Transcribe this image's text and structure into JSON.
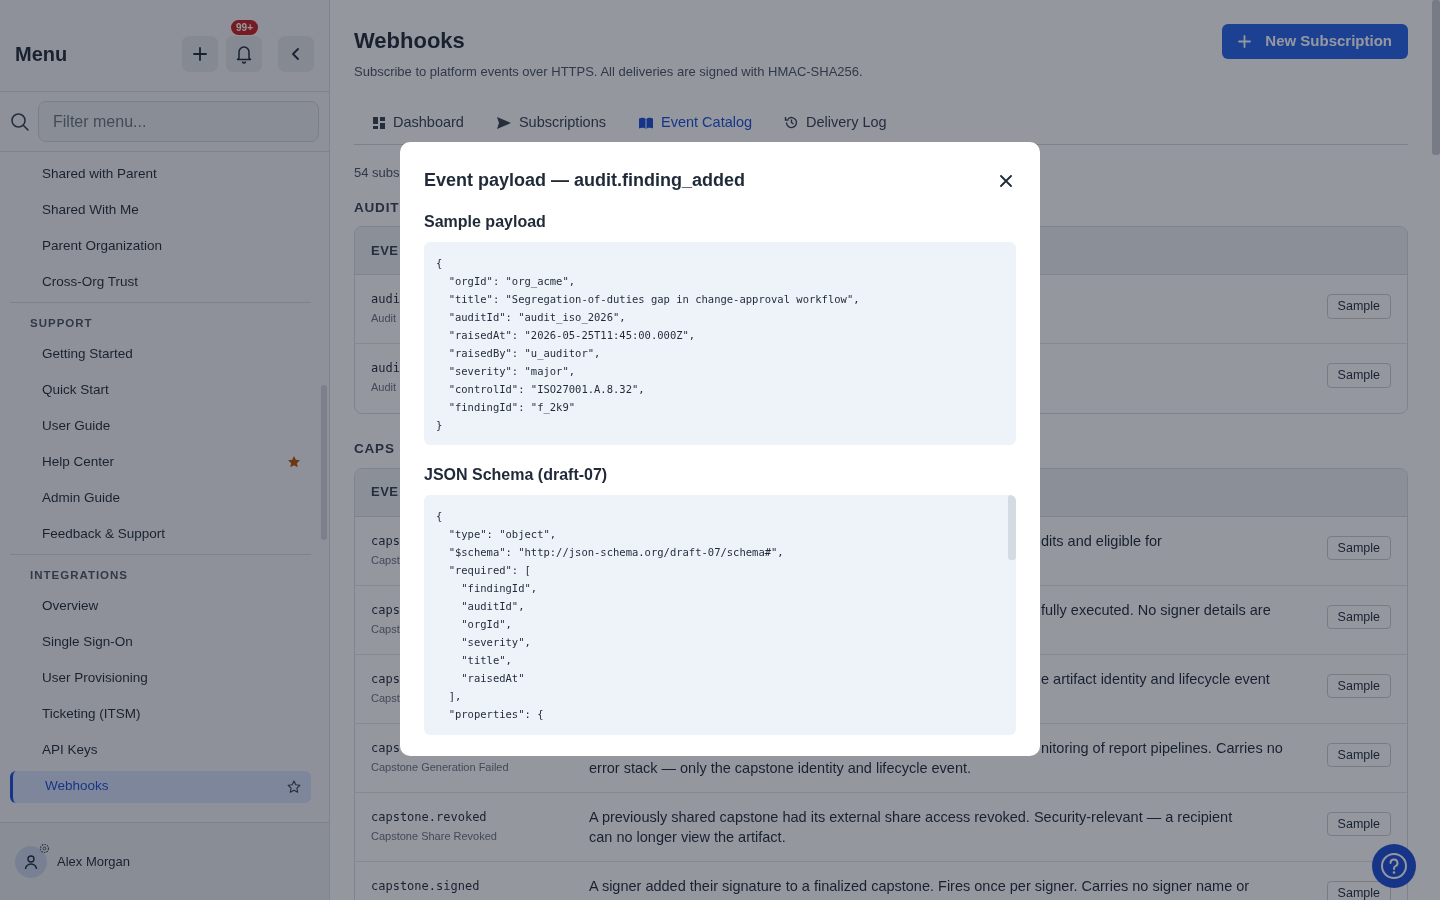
{
  "sidebar": {
    "title": "Menu",
    "notification_badge": "99+",
    "search": {
      "placeholder": "Filter menu..."
    },
    "sections": [
      {
        "items": [
          {
            "label": "Shared with Parent",
            "selected": false
          },
          {
            "label": "Shared With Me",
            "selected": false
          },
          {
            "label": "Parent Organization",
            "selected": false
          },
          {
            "label": "Cross-Org Trust",
            "selected": false
          }
        ]
      },
      {
        "heading": "SUPPORT",
        "items": [
          {
            "label": "Getting Started",
            "selected": false
          },
          {
            "label": "Quick Start",
            "selected": false
          },
          {
            "label": "User Guide",
            "selected": false
          },
          {
            "label": "Help Center",
            "selected": false,
            "favorite": true
          },
          {
            "label": "Admin Guide",
            "selected": false
          },
          {
            "label": "Feedback & Support",
            "selected": false
          }
        ]
      },
      {
        "heading": "INTEGRATIONS",
        "items": [
          {
            "label": "Overview",
            "selected": false
          },
          {
            "label": "Single Sign-On",
            "selected": false
          },
          {
            "label": "User Provisioning",
            "selected": false
          },
          {
            "label": "Ticketing (ITSM)",
            "selected": false
          },
          {
            "label": "API Keys",
            "selected": false
          },
          {
            "label": "Webhooks",
            "selected": true
          }
        ]
      }
    ],
    "user": {
      "name": "Alex Morgan"
    }
  },
  "page": {
    "title": "Webhooks",
    "subtitle": "Subscribe to platform events over HTTPS. All deliveries are signed with HMAC-SHA256.",
    "new_button": "New Subscription",
    "tabs": [
      {
        "label": "Dashboard",
        "selected": false
      },
      {
        "label": "Subscriptions",
        "selected": false
      },
      {
        "label": "Event Catalog",
        "selected": true
      },
      {
        "label": "Delivery Log",
        "selected": false
      }
    ],
    "count_text": "54 subs",
    "groups": [
      {
        "heading": "AUDIT",
        "column_header": "EVE",
        "rows": [
          {
            "code": "audi",
            "name": "Audit",
            "button": "Sample"
          },
          {
            "code": "audi",
            "name": "Audit",
            "button": "Sample"
          }
        ]
      },
      {
        "heading": "CAPS",
        "column_header": "EVE",
        "rows": [
          {
            "code": "caps",
            "name": "Capst",
            "description": [
              {
                "text": "dits and eligible for",
                "covered": true
              }
            ],
            "button": "Sample"
          },
          {
            "code": "caps",
            "name": "Capst",
            "description": [
              {
                "text": "fully executed. No signer details are",
                "covered": true
              }
            ],
            "button": "Sample"
          },
          {
            "code": "caps",
            "name": "Capst",
            "description": [
              {
                "text": "e artifact identity and lifecycle event",
                "covered": true
              }
            ],
            "button": "Sample"
          },
          {
            "code": "caps",
            "name": "Capstone Generation Failed",
            "description": [
              {
                "text": "nitoring of report pipelines. Carries no",
                "covered": true
              },
              {
                "text": "error stack — only the capstone identity and lifecycle event.",
                "covered": false
              }
            ],
            "button": "Sample"
          },
          {
            "code": "capstone.revoked",
            "name": "Capstone Share Revoked",
            "description": [
              {
                "text": "A previously shared capstone had its external share access revoked. Security-relevant — a recipient",
                "covered": false
              },
              {
                "text": "can no longer view the artifact.",
                "covered": false
              }
            ],
            "button": "Sample"
          },
          {
            "code": "capstone.signed",
            "description": [
              {
                "text": "A signer added their signature to a finalized capstone. Fires once per signer. Carries no signer name or",
                "covered": false
              }
            ],
            "button": "Sample"
          }
        ]
      }
    ]
  },
  "modal": {
    "title": "Event payload — audit.finding_added",
    "sections": [
      {
        "heading": "Sample payload",
        "scrollable": false,
        "code": "{\n  \"orgId\": \"org_acme\",\n  \"title\": \"Segregation-of-duties gap in change-approval workflow\",\n  \"auditId\": \"audit_iso_2026\",\n  \"raisedAt\": \"2026-05-25T11:45:00.000Z\",\n  \"raisedBy\": \"u_auditor\",\n  \"severity\": \"major\",\n  \"controlId\": \"ISO27001.A.8.32\",\n  \"findingId\": \"f_2k9\"\n}"
      },
      {
        "heading": "JSON Schema (draft-07)",
        "scrollable": true,
        "code": "{\n  \"type\": \"object\",\n  \"$schema\": \"http://json-schema.org/draft-07/schema#\",\n  \"required\": [\n    \"findingId\",\n    \"auditId\",\n    \"orgId\",\n    \"severity\",\n    \"title\",\n    \"raisedAt\"\n  ],\n  \"properties\": {"
      }
    ]
  }
}
